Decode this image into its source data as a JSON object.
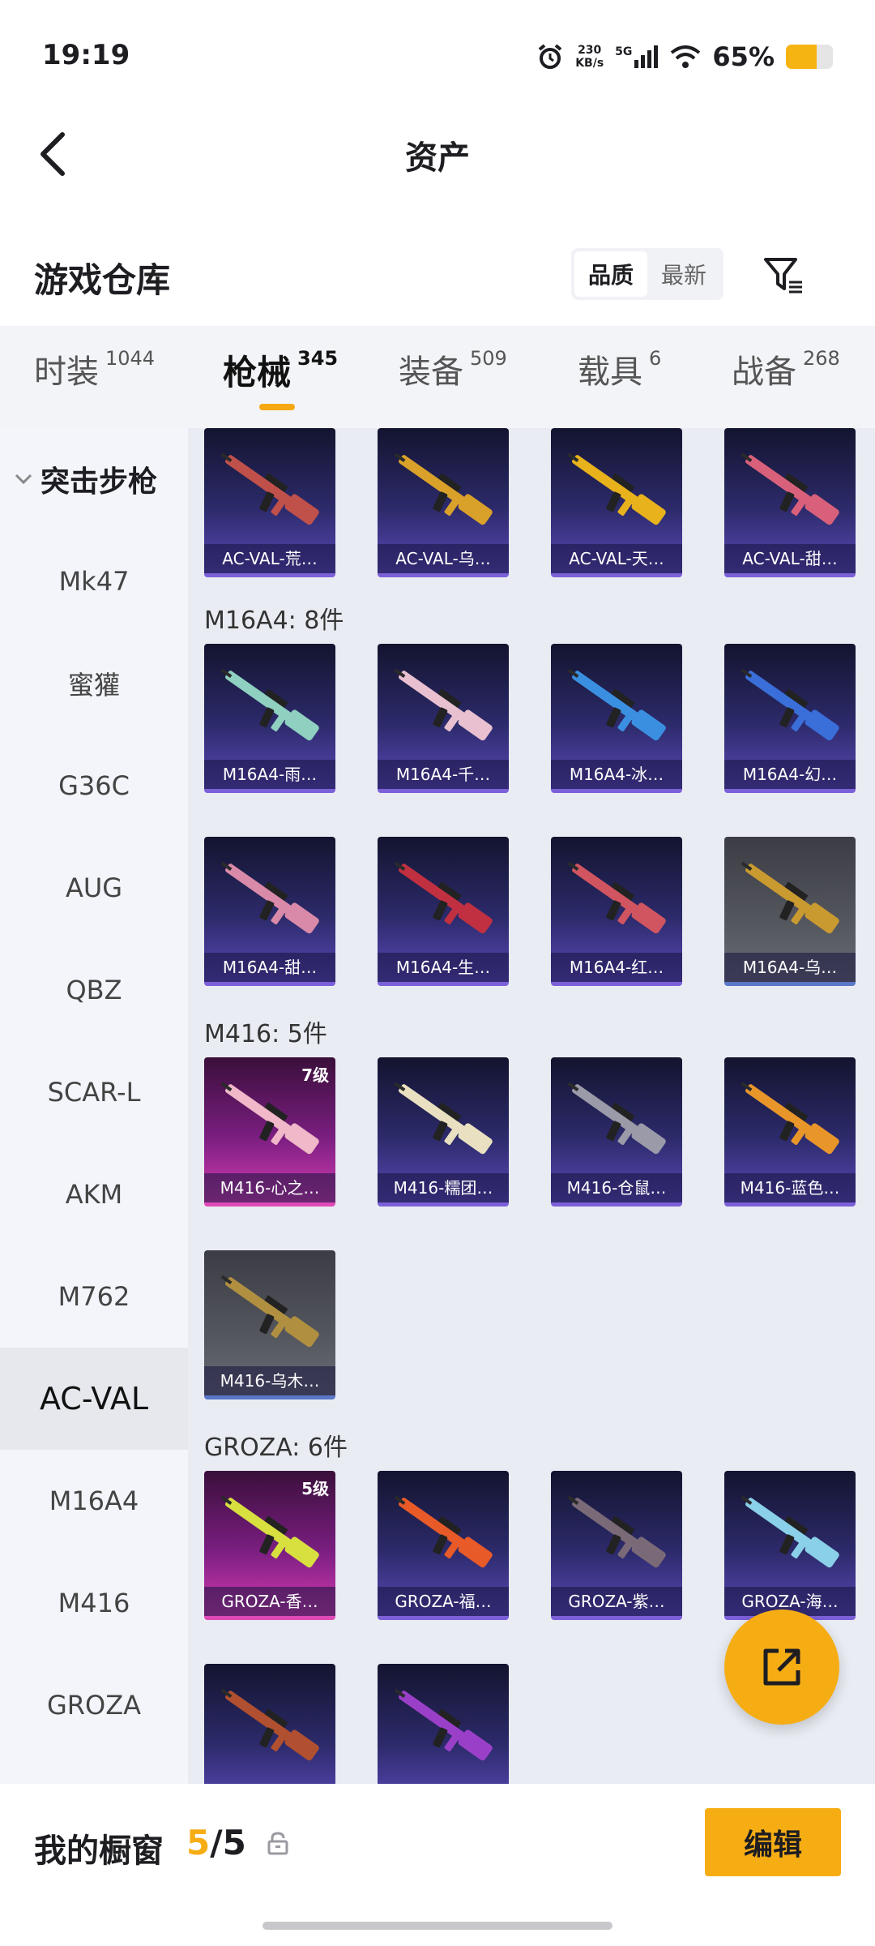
{
  "status_bar": {
    "time": "19:19",
    "net_speed_value": "230",
    "net_speed_unit": "KB/s",
    "network": "5G",
    "battery_text": "65%",
    "battery_level": 0.65,
    "battery_color": "#f6b412"
  },
  "nav": {
    "title": "资产",
    "back_icon": "chevron-left-icon"
  },
  "header": {
    "title": "游戏仓库",
    "sort_options": [
      "品质",
      "最新"
    ],
    "sort_selected": "品质",
    "filter_icon": "filter-icon"
  },
  "tabs": [
    {
      "label": "时装",
      "count": "1044"
    },
    {
      "label": "枪械",
      "count": "345",
      "active": true
    },
    {
      "label": "装备",
      "count": "509"
    },
    {
      "label": "载具",
      "count": "6"
    },
    {
      "label": "战备",
      "count": "268"
    }
  ],
  "sidebar": {
    "category": "突击步枪",
    "items": [
      {
        "label": "Mk47"
      },
      {
        "label": "蜜獾"
      },
      {
        "label": "G36C"
      },
      {
        "label": "AUG"
      },
      {
        "label": "QBZ"
      },
      {
        "label": "SCAR-L"
      },
      {
        "label": "AKM"
      },
      {
        "label": "M762"
      },
      {
        "label": "AC-VAL",
        "active": true
      },
      {
        "label": "M16A4"
      },
      {
        "label": "M416"
      },
      {
        "label": "GROZA"
      }
    ]
  },
  "groups": [
    {
      "label": "",
      "items": [
        {
          "name": "AC-VAL-荒…",
          "quality": "purple",
          "color": "#c0504a"
        },
        {
          "name": "AC-VAL-乌…",
          "quality": "purple",
          "color": "#d9a12a"
        },
        {
          "name": "AC-VAL-天…",
          "quality": "purple",
          "color": "#e8b21c"
        },
        {
          "name": "AC-VAL-甜…",
          "quality": "purple",
          "color": "#d9607a"
        }
      ]
    },
    {
      "label": "M16A4: 8件",
      "items": [
        {
          "name": "M16A4-雨…",
          "quality": "purple",
          "color": "#8fd0c0"
        },
        {
          "name": "M16A4-千…",
          "quality": "purple",
          "color": "#e8c0d0"
        },
        {
          "name": "M16A4-冰…",
          "quality": "purple",
          "color": "#3b8fe0"
        },
        {
          "name": "M16A4-幻…",
          "quality": "purple",
          "color": "#3a6ed8"
        },
        {
          "name": "M16A4-甜…",
          "quality": "purple",
          "color": "#d98aa8"
        },
        {
          "name": "M16A4-生…",
          "quality": "purple",
          "color": "#c03040"
        },
        {
          "name": "M16A4-红…",
          "quality": "purple",
          "color": "#d05560"
        },
        {
          "name": "M16A4-乌…",
          "quality": "grey",
          "color": "#c99a30"
        }
      ]
    },
    {
      "label": "M416: 5件",
      "items": [
        {
          "name": "M416-心之…",
          "quality": "pink",
          "level": "7级",
          "color": "#f0b8c8"
        },
        {
          "name": "M416-糯团…",
          "quality": "purple",
          "color": "#e8e0c0"
        },
        {
          "name": "M416-仓鼠…",
          "quality": "purple",
          "color": "#9a9aa8"
        },
        {
          "name": "M416-蓝色…",
          "quality": "purple",
          "color": "#e8962a"
        },
        {
          "name": "M416-乌木…",
          "quality": "grey",
          "color": "#b09040"
        }
      ]
    },
    {
      "label": "GROZA: 6件",
      "items": [
        {
          "name": "GROZA-香…",
          "quality": "pink",
          "level": "5级",
          "color": "#d8e040"
        },
        {
          "name": "GROZA-福…",
          "quality": "purple",
          "color": "#e85a28"
        },
        {
          "name": "GROZA-紫…",
          "quality": "purple",
          "color": "#7a6a78"
        },
        {
          "name": "GROZA-海…",
          "quality": "purple",
          "color": "#8ad0e8"
        },
        {
          "name": "",
          "quality": "purple",
          "color": "#b05030"
        },
        {
          "name": "",
          "quality": "purple",
          "color": "#9a40c8"
        }
      ]
    }
  ],
  "fab": {
    "icon": "share-edit-icon"
  },
  "bottom": {
    "label": "我的橱窗",
    "count_current": "5",
    "count_total": "/5",
    "lock_icon": "lock-icon",
    "edit_label": "编辑",
    "accent": "#f6ad14"
  }
}
